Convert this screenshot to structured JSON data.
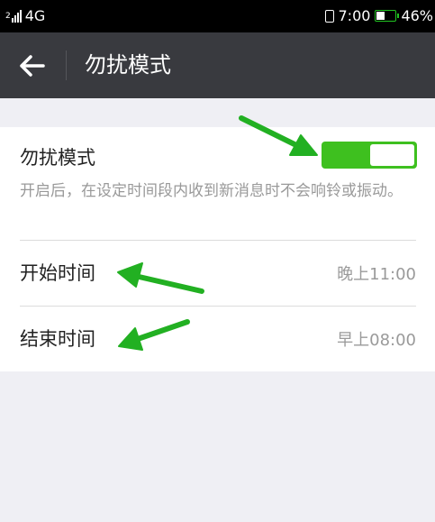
{
  "status_bar": {
    "network": "4G",
    "sim": "2",
    "time": "7:00",
    "battery": "46%",
    "battery_level": 0.46
  },
  "header": {
    "title": "勿扰模式",
    "back_icon": "back-arrow-icon"
  },
  "settings": {
    "dnd": {
      "label": "勿扰模式",
      "description": "开启后，在设定时间段内收到新消息时不会响铃或振动。",
      "enabled": true
    },
    "start_time": {
      "label": "开始时间",
      "value": "晚上11:00"
    },
    "end_time": {
      "label": "结束时间",
      "value": "早上08:00"
    }
  },
  "colors": {
    "status_bar": "#000000",
    "title_bar": "#393a3f",
    "switch_on": "#3ec01f",
    "annotation_arrow": "#22b022",
    "background": "#efeff4"
  }
}
